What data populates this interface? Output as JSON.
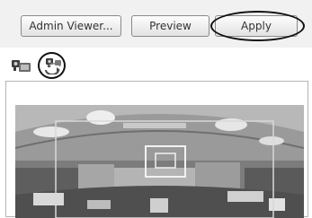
{
  "buttons": {
    "admin_viewer": "Admin Viewer...",
    "preview": "Preview",
    "apply": "Apply"
  },
  "icons": {
    "camera": "camera-icon",
    "camera_sync": "camera-sync-icon"
  },
  "colors": {
    "toolbar_bg": "#f1f1f1",
    "annotation": "#111111"
  }
}
